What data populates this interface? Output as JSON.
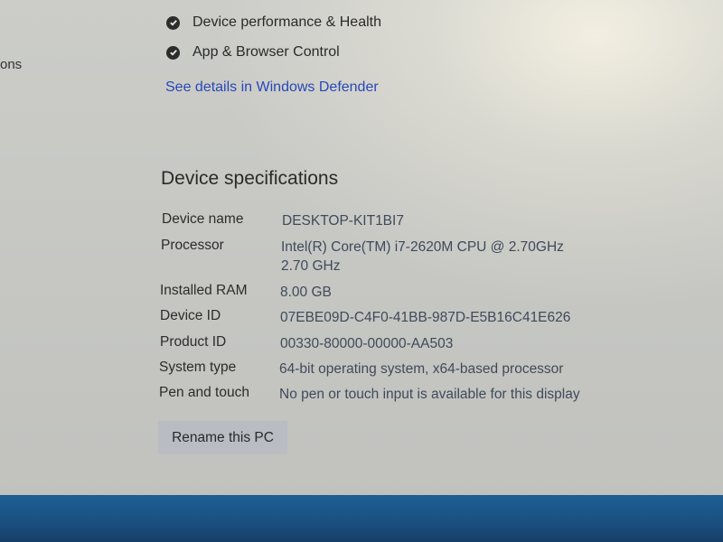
{
  "left_fragment": "ons",
  "status_items": [
    {
      "label": "Device performance & Health",
      "icon": "check-circle-icon"
    },
    {
      "label": "App & Browser Control",
      "icon": "check-circle-icon"
    }
  ],
  "defender_link": "See details in Windows Defender",
  "section_title": "Device specifications",
  "specs": {
    "device_name": {
      "label": "Device name",
      "value": "DESKTOP-KIT1BI7"
    },
    "processor": {
      "label": "Processor",
      "value_line1": "Intel(R) Core(TM) i7-2620M CPU @ 2.70GHz",
      "value_line2": "2.70 GHz"
    },
    "installed_ram": {
      "label": "Installed RAM",
      "value": "8.00 GB"
    },
    "device_id": {
      "label": "Device ID",
      "value": "07EBE09D-C4F0-41BB-987D-E5B16C41E626"
    },
    "product_id": {
      "label": "Product ID",
      "value": "00330-80000-00000-AA503"
    },
    "system_type": {
      "label": "System type",
      "value": "64-bit operating system, x64-based processor"
    },
    "pen_touch": {
      "label": "Pen and touch",
      "value": "No pen or touch input is available for this display"
    }
  },
  "rename_button": "Rename this PC",
  "colors": {
    "link": "#2748b8",
    "button_bg": "#b9bcc3",
    "taskbar": "#1e5f95"
  }
}
